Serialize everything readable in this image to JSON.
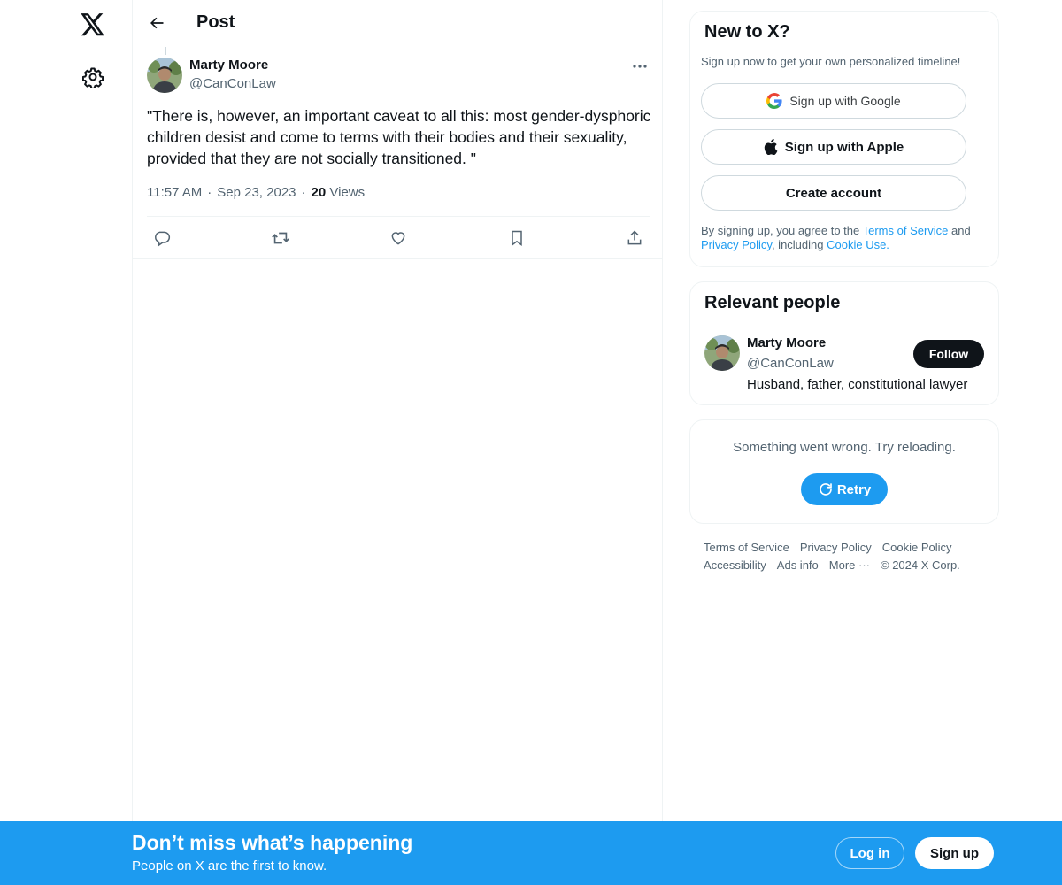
{
  "nav": {
    "logo_icon": "x-logo-icon",
    "settings_icon": "gear-icon"
  },
  "header": {
    "title": "Post"
  },
  "post": {
    "author_name": "Marty Moore",
    "author_handle": "@CanConLaw",
    "text": "\"There is, however, an important caveat to all this: most gender-dysphoric children desist and come to terms with their bodies and their sexuality, provided that they are not socially transitioned. \"",
    "time": "11:57 AM",
    "date": "Sep 23, 2023",
    "views_count": "20",
    "views_label": "Views",
    "actions": [
      "reply-icon",
      "repost-icon",
      "like-icon",
      "bookmark-icon",
      "share-icon"
    ]
  },
  "signup_card": {
    "title": "New to X?",
    "subtitle": "Sign up now to get your own personalized timeline!",
    "google_label": "Sign up with Google",
    "apple_label": "Sign up with Apple",
    "create_label": "Create account",
    "terms_prefix": "By signing up, you agree to the ",
    "terms_link": "Terms of Service",
    "terms_and": " and ",
    "privacy_link": "Privacy Policy",
    "including": ", including ",
    "cookie_link": "Cookie Use."
  },
  "relevant_people": {
    "title": "Relevant people",
    "name": "Marty Moore",
    "handle": "@CanConLaw",
    "bio": "Husband, father, constitutional lawyer",
    "follow_label": "Follow"
  },
  "error_card": {
    "message": "Something went wrong. Try reloading.",
    "retry_label": "Retry"
  },
  "footer": {
    "links": [
      "Terms of Service",
      "Privacy Policy",
      "Cookie Policy",
      "Accessibility",
      "Ads info",
      "More ···",
      "© 2024 X Corp."
    ]
  },
  "banner": {
    "title": "Don’t miss what’s happening",
    "subtitle": "People on X are the first to know.",
    "login_label": "Log in",
    "signup_label": "Sign up"
  },
  "colors": {
    "accent": "#1d9bf0",
    "text": "#0f1419",
    "secondary": "#536471",
    "border": "#eff3f4"
  }
}
